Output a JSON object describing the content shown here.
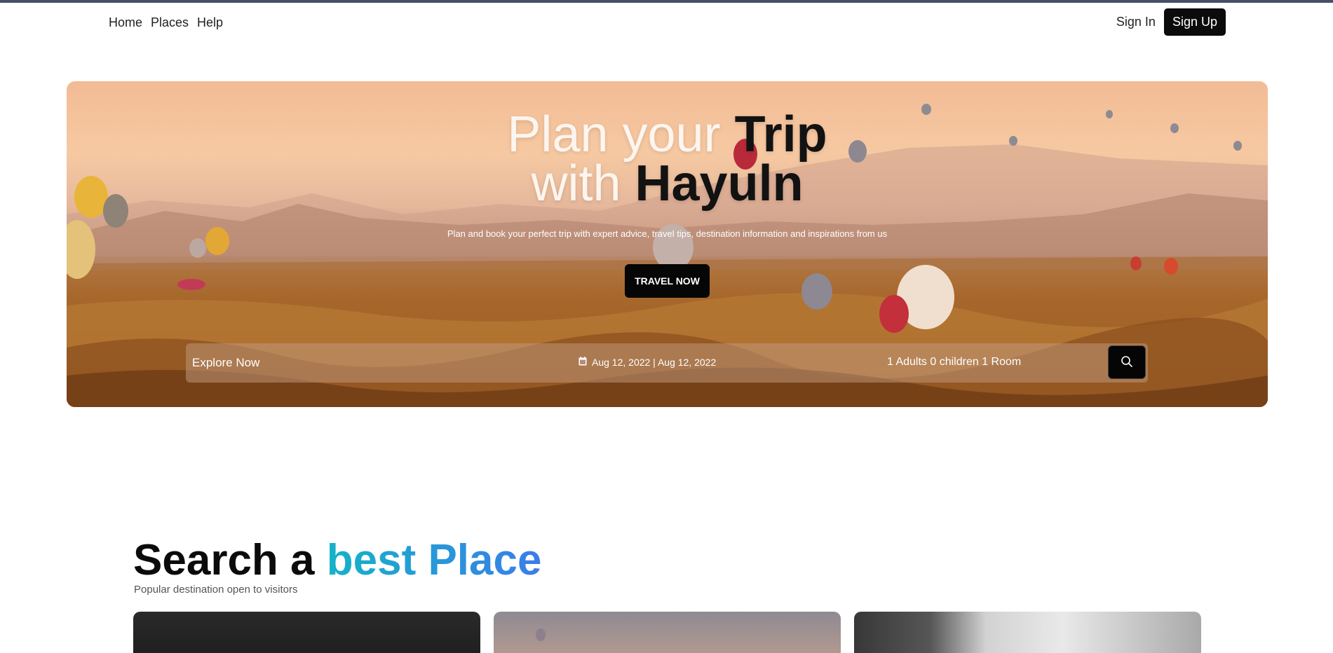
{
  "nav": {
    "links": [
      "Home",
      "Places",
      "Help"
    ],
    "signin_label": "Sign In",
    "signup_label": "Sign Up"
  },
  "hero": {
    "title_line1_light": "Plan your ",
    "title_line1_bold": "Trip",
    "title_line2_light": "with ",
    "title_line2_bold": "Hayuln",
    "subtitle": "Plan and book your perfect trip with expert advice, travel tips, destination information and inspirations from us",
    "cta_label": "TRAVEL NOW"
  },
  "search": {
    "placeholder": "Explore Now",
    "date_icon": "calendar-icon",
    "dates": "Aug 12, 2022 | Aug 12, 2022",
    "guests": "1 Adults 0 children 1 Room",
    "button_icon": "search-icon"
  },
  "section": {
    "title_part1": "Search a ",
    "title_highlight": "best Place",
    "subtitle": "Popular destination open to visitors",
    "accent_start": "#14b3c8",
    "accent_end": "#3b7de8"
  },
  "colors": {
    "topline": "#47506a",
    "button_dark": "#060606"
  }
}
